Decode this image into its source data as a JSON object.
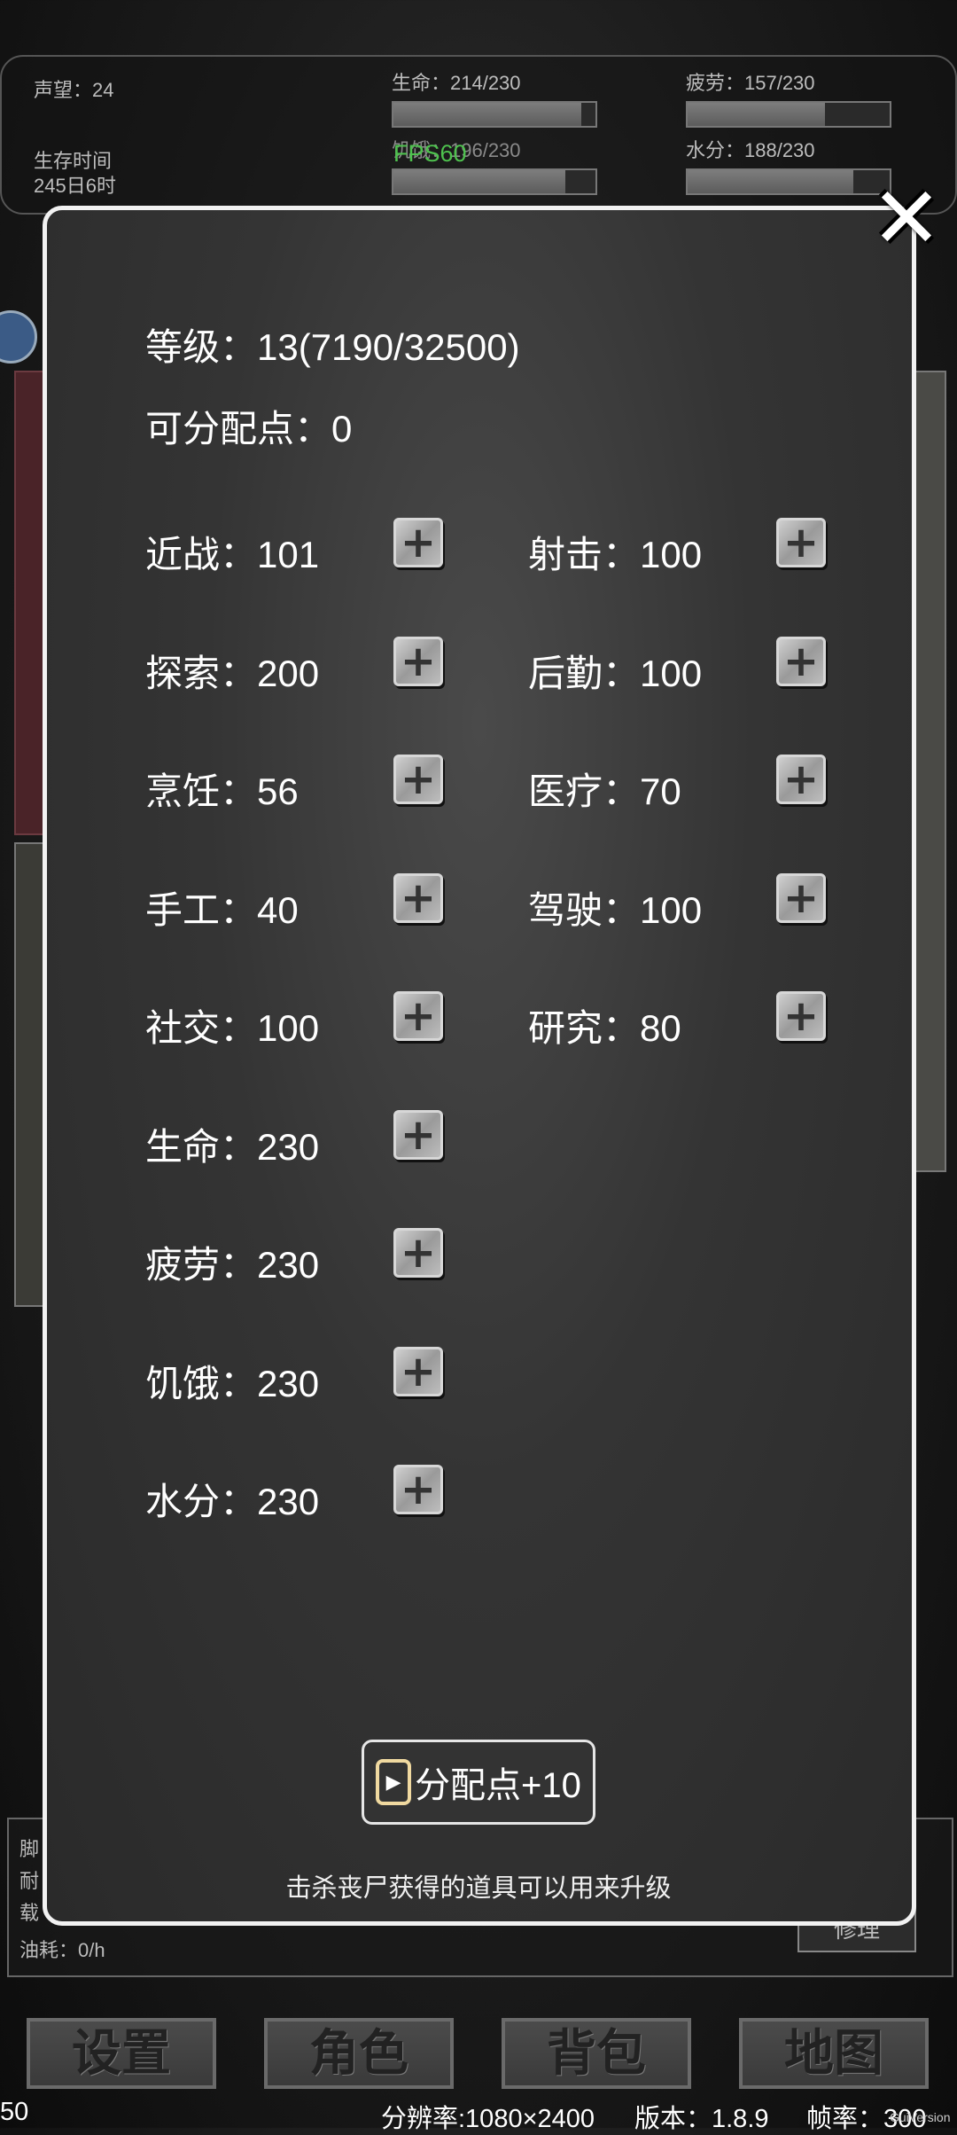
{
  "hud": {
    "reputation": "声望：24",
    "survival_label": "生存时间",
    "survival_value": "245日6时",
    "life": "生命：214/230",
    "life_fraction": 0.93,
    "fatigue": "疲劳：157/230",
    "fatigue_fraction": 0.68,
    "hunger": "饥饿：196/230",
    "hunger_fraction": 0.85,
    "water": "水分：188/230",
    "water_fraction": 0.82,
    "fps": "FPS60"
  },
  "modal": {
    "level": "等级：13(7190/32500)",
    "points": "可分配点：0",
    "close_icon": "close-x-icon",
    "attributes_left": [
      {
        "label": "近战：101"
      },
      {
        "label": "探索：200"
      },
      {
        "label": "烹饪：56"
      },
      {
        "label": "手工：40"
      },
      {
        "label": "社交：100"
      },
      {
        "label": "生命：230"
      },
      {
        "label": "疲劳：230"
      },
      {
        "label": "饥饿：230"
      },
      {
        "label": "水分：230"
      }
    ],
    "attributes_right": [
      {
        "label": "射击：100"
      },
      {
        "label": "后勤：100"
      },
      {
        "label": "医疗：70"
      },
      {
        "label": "驾驶：100"
      },
      {
        "label": "研究：80"
      }
    ],
    "plus_symbol": "+",
    "ad_button_label": "分配点+10",
    "hint": "击杀丧尸获得的道具可以用来升级"
  },
  "vehicle": {
    "line1": "脚",
    "line2": "耐",
    "line3": "载",
    "fuel": "油耗：0/h",
    "repair": "修理"
  },
  "nav": {
    "settings": "设置",
    "character": "角色",
    "bag": "背包",
    "map": "地图"
  },
  "status": {
    "left": "50",
    "resolution": "分辨率:1080×2400",
    "version": "版本：1.8.9",
    "framerate": "帧率：300",
    "watermark": "GuiVersion"
  }
}
